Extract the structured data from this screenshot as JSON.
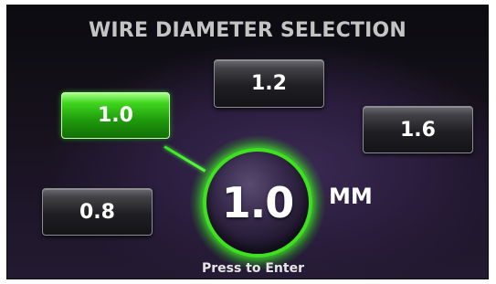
{
  "screen": {
    "title": "WIRE DIAMETER SELECTION",
    "options": [
      {
        "label": "1.2",
        "selected": false
      },
      {
        "label": "1.0",
        "selected": true
      },
      {
        "label": "1.6",
        "selected": false
      },
      {
        "label": "0.8",
        "selected": false
      }
    ],
    "current_value": "1.0",
    "unit": "MM",
    "hint": "Press to Enter"
  },
  "colors": {
    "selected_accent": "#3ee01f",
    "background": "#1d1528",
    "title_text": "#c4c4c4"
  },
  "icons": {
    "connector": "selection-connector-line"
  }
}
